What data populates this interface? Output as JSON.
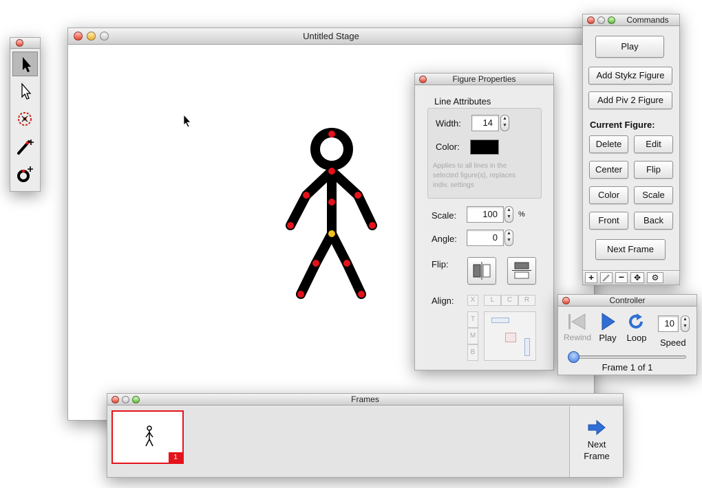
{
  "stage": {
    "title": "Untitled Stage"
  },
  "frames": {
    "title": "Frames",
    "frame_number": "1",
    "next_frame_line1": "Next",
    "next_frame_line2": "Frame"
  },
  "figure_properties": {
    "title": "Figure Properties",
    "line_attributes_label": "Line Attributes",
    "width_label": "Width:",
    "width_value": "14",
    "color_label": "Color:",
    "line_color": "#000000",
    "note_line1": "Applies to all lines in the",
    "note_line2": "selected figure(s), replaces",
    "note_line3": "indiv. settings",
    "scale_label": "Scale:",
    "scale_value": "100",
    "scale_unit": "%",
    "angle_label": "Angle:",
    "angle_value": "0",
    "flip_label": "Flip:",
    "align_label": "Align:",
    "align_x": "X",
    "align_l": "L",
    "align_c": "C",
    "align_r": "R",
    "align_t": "T",
    "align_m": "M",
    "align_b": "B"
  },
  "commands": {
    "title": "Commands",
    "play": "Play",
    "add_stykz": "Add Stykz Figure",
    "add_piv2": "Add Piv 2 Figure",
    "current_figure": "Current Figure:",
    "delete": "Delete",
    "edit": "Edit",
    "center": "Center",
    "flip": "Flip",
    "color": "Color",
    "scale": "Scale",
    "front": "Front",
    "back": "Back",
    "next_frame": "Next Frame",
    "bottom_icons": [
      "plus-icon",
      "pencil-icon",
      "minus-icon",
      "move-icon",
      "gear-icon"
    ]
  },
  "controller": {
    "title": "Controller",
    "rewind": "Rewind",
    "play": "Play",
    "loop": "Loop",
    "speed_label": "Speed",
    "speed_value": "10",
    "frame_status": "Frame 1 of 1",
    "position_fraction": 0
  },
  "toolbox": {
    "tools": [
      "select-arrow-icon",
      "direct-select-icon",
      "target-icon",
      "add-line-icon",
      "add-circle-icon"
    ]
  },
  "colors": {
    "joint": "#e5121b",
    "center_joint": "#f2c01e",
    "accent_blue": "#2f6fd6",
    "frame_selected": "#e5121b"
  }
}
